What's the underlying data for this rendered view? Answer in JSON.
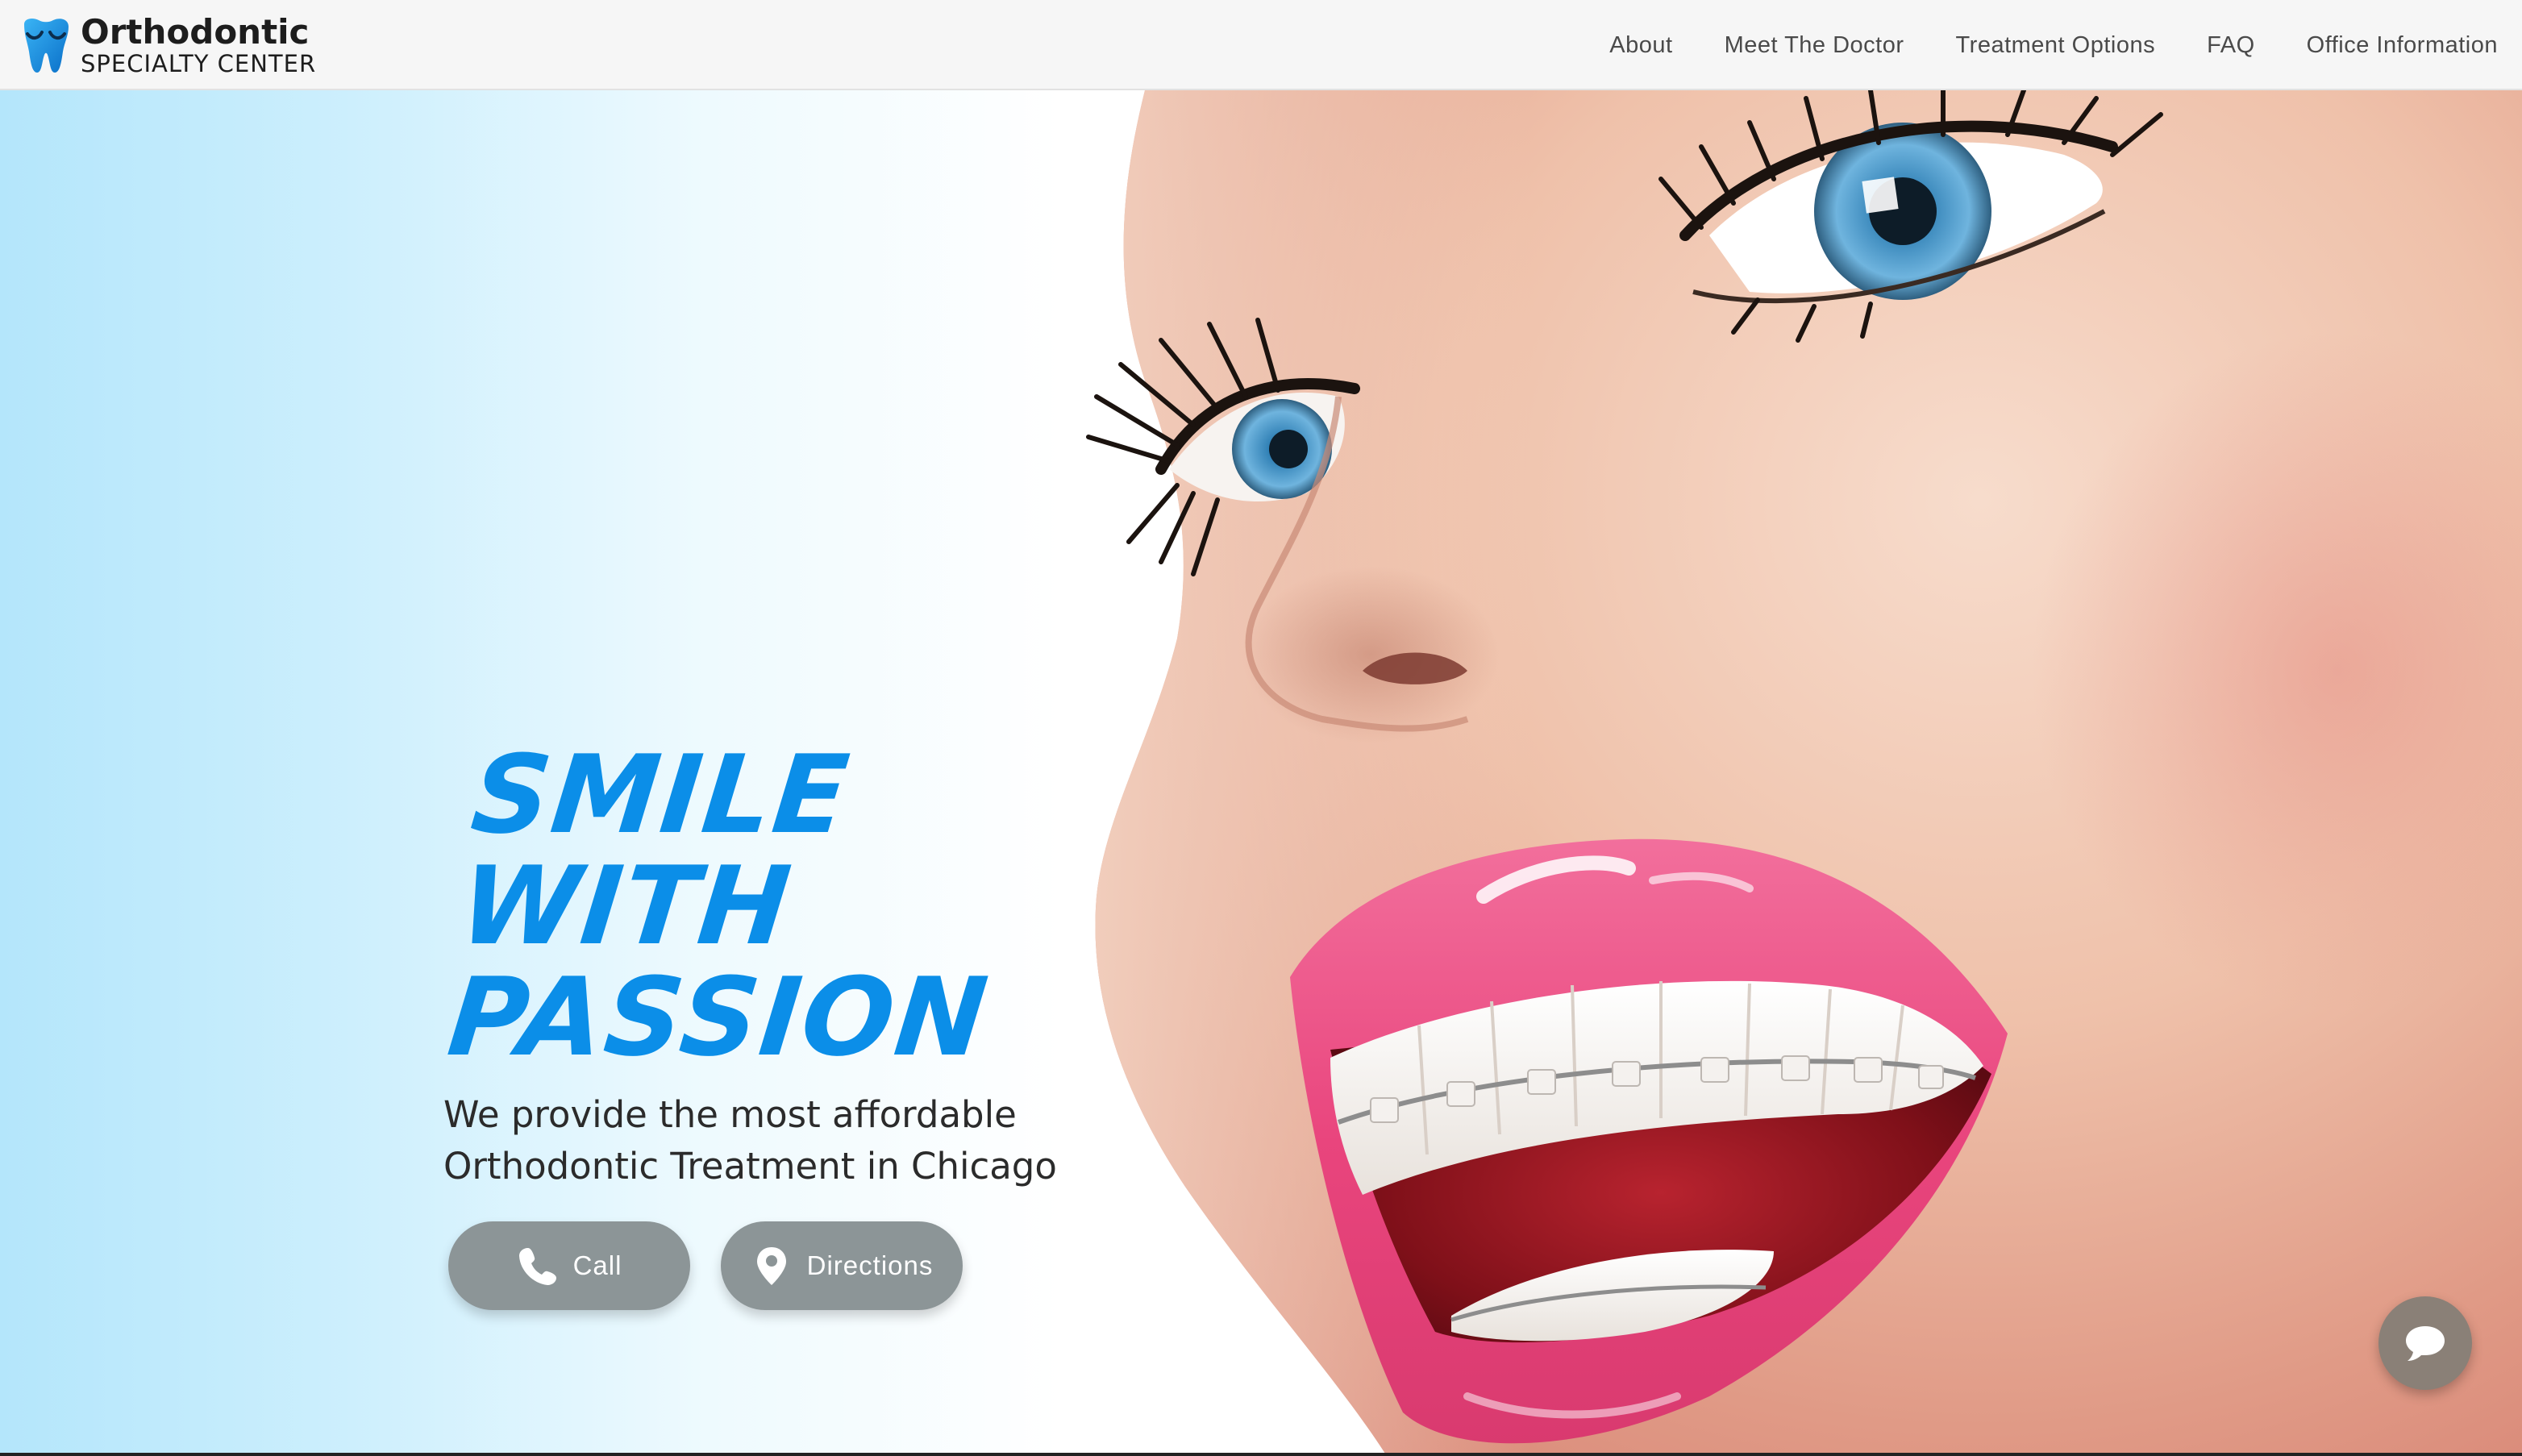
{
  "header": {
    "logo": {
      "title": "Orthodontic",
      "subtitle": "SPECIALTY CENTER",
      "icon": "tooth-icon"
    },
    "nav": [
      {
        "label": "About"
      },
      {
        "label": "Meet The Doctor"
      },
      {
        "label": "Treatment Options"
      },
      {
        "label": "FAQ"
      },
      {
        "label": "Office Information"
      }
    ]
  },
  "hero": {
    "heading_lines": [
      "SMILE",
      "WITH",
      "PASSION"
    ],
    "tagline_lines": [
      "We provide the most affordable",
      "Orthodontic Treatment in Chicago"
    ],
    "buttons": {
      "call": {
        "label": "Call",
        "icon": "phone-icon"
      },
      "directions": {
        "label": "Directions",
        "icon": "map-pin-icon"
      }
    }
  },
  "chat": {
    "icon": "chat-bubble-icon"
  },
  "colors": {
    "accent": "#0b8ee8",
    "button_bg": "#8c9597",
    "chat_bg": "#8a8077",
    "header_bg": "#f6f6f6"
  }
}
